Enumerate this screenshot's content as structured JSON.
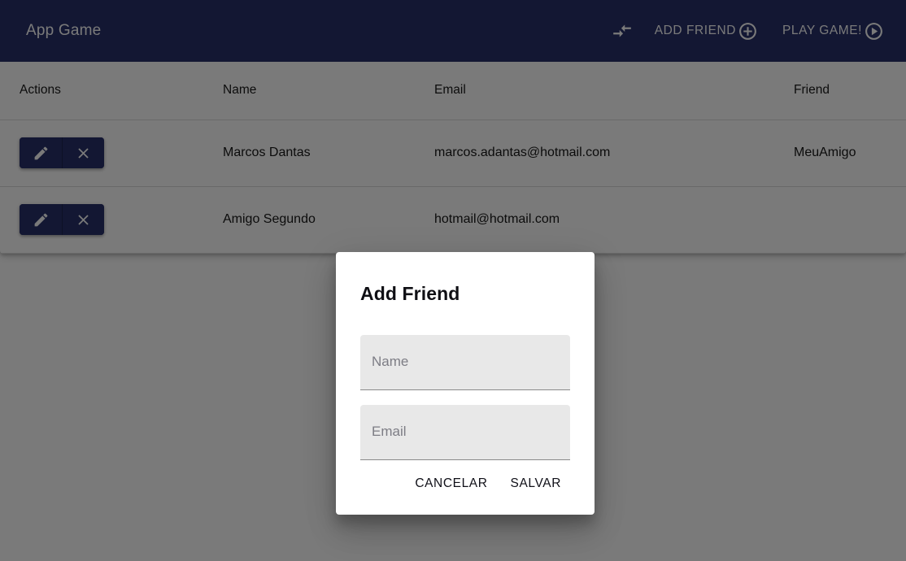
{
  "theme": {
    "primary": "#28306b",
    "surface": "#ffffff",
    "scrim": "rgba(0,0,0,0.52)",
    "field_background": "#e8e8e8",
    "text_primary": "#1f1f1f"
  },
  "toolbar": {
    "title": "App Game",
    "actions": [
      {
        "name": "compare-arrows",
        "label": "",
        "icon": "compare-arrows-icon"
      },
      {
        "name": "add-friend",
        "label": "ADD FRIEND",
        "icon": "add-circle-outline-icon"
      },
      {
        "name": "play-game",
        "label": "PLAY GAME!",
        "icon": "play-circle-outline-icon"
      }
    ]
  },
  "table": {
    "columns": [
      "Actions",
      "Name",
      "Email",
      "Friend"
    ],
    "row_actions": [
      {
        "name": "edit",
        "icon": "pencil-icon"
      },
      {
        "name": "delete",
        "icon": "close-x-icon"
      }
    ],
    "rows": [
      {
        "name": "Marcos Dantas",
        "email": "marcos.adantas@hotmail.com",
        "friend": "MeuAmigo"
      },
      {
        "name": "Amigo Segundo",
        "email": "hotmail@hotmail.com",
        "friend": ""
      }
    ]
  },
  "dialog": {
    "title": "Add Friend",
    "fields": [
      {
        "name": "name",
        "placeholder": "Name",
        "value": ""
      },
      {
        "name": "email",
        "placeholder": "Email",
        "value": ""
      }
    ],
    "cancel_label": "CANCELAR",
    "save_label": "SALVAR"
  }
}
